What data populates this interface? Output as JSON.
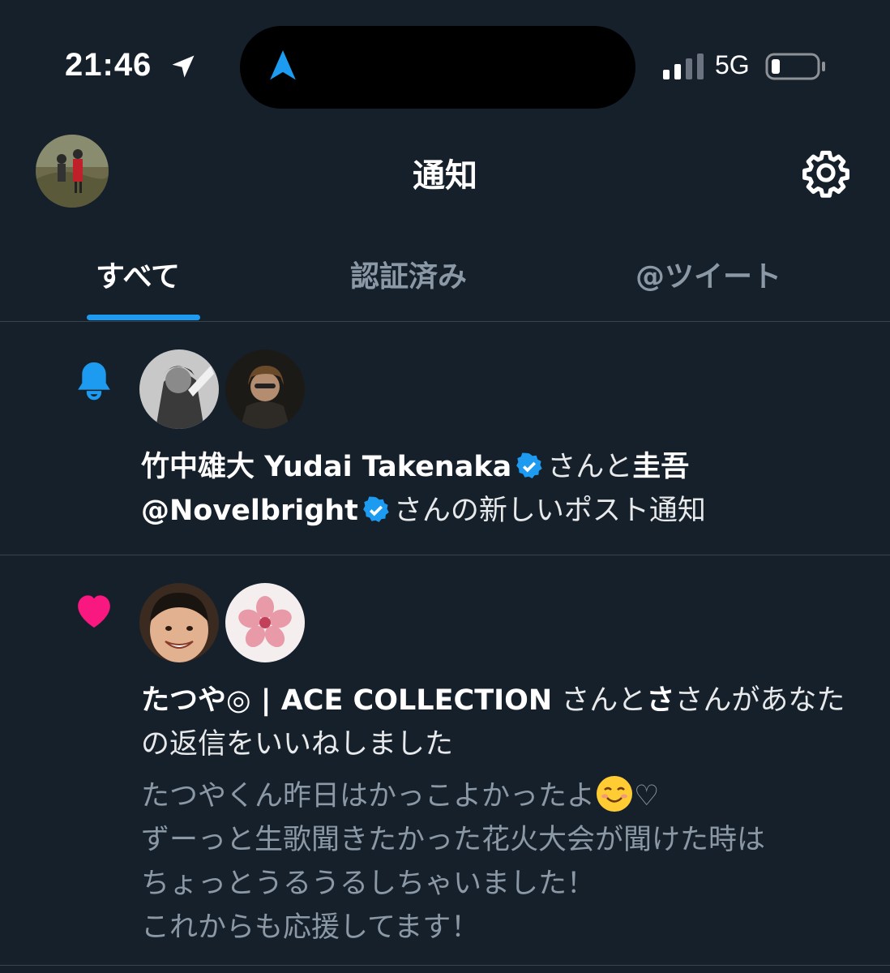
{
  "status_bar": {
    "time": "21:46",
    "network": "5G",
    "icons": [
      "location-arrow-icon",
      "maps-navigation-icon",
      "signal-icon",
      "battery-icon"
    ]
  },
  "header": {
    "title": "通知",
    "icons": [
      "avatar",
      "gear-icon"
    ]
  },
  "tabs": [
    {
      "label": "すべて",
      "selected": true
    },
    {
      "label": "認証済み",
      "selected": false
    },
    {
      "label": "@ツイート",
      "selected": false
    }
  ],
  "notifications": [
    {
      "type_icon": "bell-icon",
      "user1": "竹中雄大 Yudai Takenaka",
      "connector1": "さんと",
      "user2": "圭吾",
      "user2_handle": "@Novelbright",
      "suffix": "さんの新しいポスト通知"
    },
    {
      "type_icon": "heart-icon",
      "user1": "たつや◎ | ACE COLLECTION",
      "connector1": "さんと",
      "user2": "さ",
      "suffix": "さんがあなたの返信をいいねしました",
      "reply_line1": "たつやくん昨日はかっこよかったよ",
      "reply_line1_tail": "♡",
      "reply_rest": "ずーっと生歌聞きたかった花火大会が聞けた時は\nちょっとうるうるしちゃいました！\nこれからも応援してます！"
    }
  ],
  "colors": {
    "background": "#15202b",
    "accent": "#1d9bf0",
    "like": "#f91880",
    "divider": "#38444d",
    "secondary_text": "#8b98a5"
  }
}
